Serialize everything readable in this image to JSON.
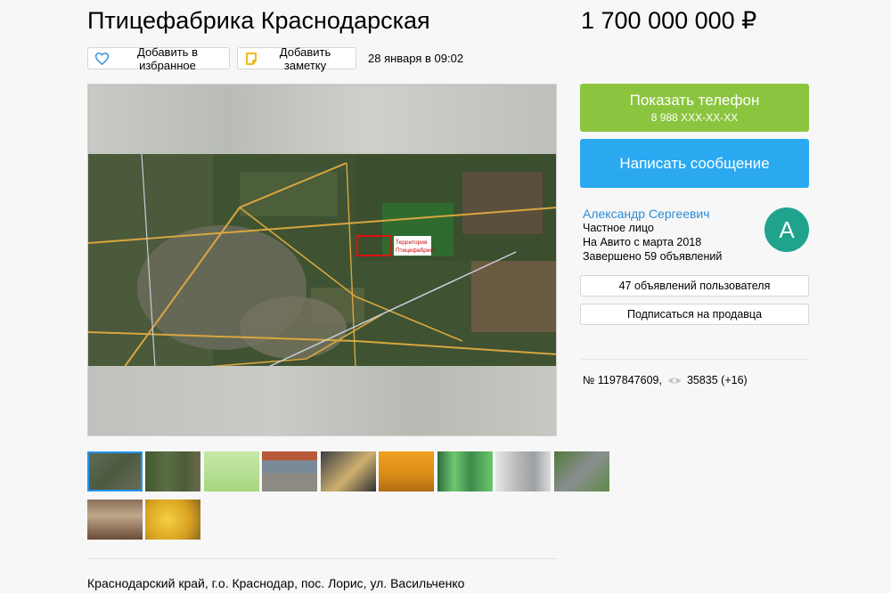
{
  "listing": {
    "title": "Птицефабрика Краснодарская",
    "price": "1 700 000 000 ₽",
    "date": "28 января в 09:02",
    "address": "Краснодарский край, г.о. Краснодар, пос. Лорис, ул. Васильченко"
  },
  "actions": {
    "favorite_label": "Добавить в избранное",
    "note_label": "Добавить заметку"
  },
  "gallery": {
    "map_label_line1": "Территория",
    "map_label_line2": "Птицефабрики",
    "thumbnail_count": 11
  },
  "contact": {
    "show_phone_label": "Показать телефон",
    "phone_masked": "8 988 XXX-XX-XX",
    "message_label": "Написать сообщение"
  },
  "seller": {
    "name": "Александр Сергеевич",
    "type": "Частное лицо",
    "since": "На Авито с марта 2018",
    "completed": "Завершено 59 объявлений",
    "avatar_letter": "А",
    "listings_button": "47 объявлений пользователя",
    "subscribe_button": "Подписаться на продавца"
  },
  "stats": {
    "ad_number": "№ 1197847609,",
    "views": "35835 (+16)"
  },
  "colors": {
    "phone_button": "#8bc53f",
    "message_button": "#2aa9f1",
    "seller_link": "#2c8bd6",
    "avatar_bg": "#1fa38d",
    "thumb_active_border": "#2196f3"
  }
}
